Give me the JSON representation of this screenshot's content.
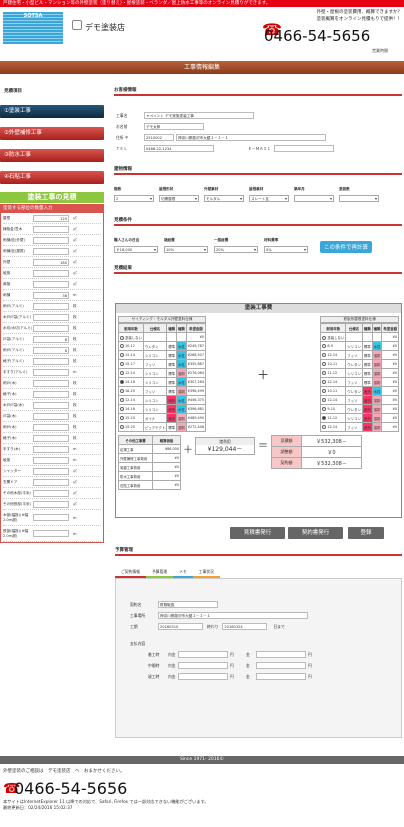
{
  "header": {
    "topbar": "戸建住宅・小型ビル・マンション等の外壁塗装（塗り替え）・屋根塗装・ベランダ／屋上防水工事等のオンライン見積りができます。",
    "logo_text": "SOTSA",
    "logo_sub": "",
    "shop_name": "デモ塗装店",
    "note1": "外壁・屋根の塗装費用、概算できますか？",
    "note2": "塗装概算をオンライン見積もりで提供！！",
    "phone": "0466-54-5656",
    "hours": "営業時間"
  },
  "title": "工事情報編集",
  "sidebar": {
    "head": "見積項目",
    "items": [
      "①塗装工事",
      "②外壁補修工事",
      "③防水工事",
      "④石貼工事"
    ],
    "estimate_title": "塗装工事の見積",
    "subhead": "塗装する部位の数量入力",
    "rows": [
      {
        "label": "屋根",
        "value": "120",
        "unit": "㎡"
      },
      {
        "label": "棟板金/笠木",
        "value": "",
        "unit": "㎡"
      },
      {
        "label": "雨樋/庇(外壁)",
        "value": "",
        "unit": "㎡"
      },
      {
        "label": "雨樋/庇(屋根)",
        "value": "",
        "unit": "㎡"
      },
      {
        "label": "外壁",
        "value": "180",
        "unit": "㎡"
      },
      {
        "label": "破風",
        "value": "",
        "unit": "㎡"
      },
      {
        "label": "鼻隠",
        "value": "",
        "unit": "㎡"
      },
      {
        "label": "雨樋",
        "value": "38",
        "unit": "m"
      },
      {
        "label": "雨戸(アルミ)",
        "value": "",
        "unit": "枚"
      },
      {
        "label": "木戸戸袋(アルミ)",
        "value": "",
        "unit": "枚"
      },
      {
        "label": "水切/水切(アルミ)",
        "value": "",
        "unit": "枚"
      },
      {
        "label": "戸袋(アルミ)",
        "value": "8",
        "unit": "枚"
      },
      {
        "label": "雨戸(アルミ)",
        "value": "8",
        "unit": "枚"
      },
      {
        "label": "格子(アルミ)",
        "value": "",
        "unit": "枚"
      },
      {
        "label": "手すり(アルミ)",
        "value": "",
        "unit": "m"
      },
      {
        "label": "雨戸(木)",
        "value": "",
        "unit": "枚"
      },
      {
        "label": "格子(木)",
        "value": "",
        "unit": "枚"
      },
      {
        "label": "木戸戸袋(木)",
        "value": "",
        "unit": "枚"
      },
      {
        "label": "戸袋(木)",
        "value": "",
        "unit": "枚"
      },
      {
        "label": "雨戸(木)",
        "value": "",
        "unit": "枚"
      },
      {
        "label": "格子(木)",
        "value": "",
        "unit": "枚"
      },
      {
        "label": "手すり(木)",
        "value": "",
        "unit": "m"
      },
      {
        "label": "破風",
        "value": "",
        "unit": "m"
      },
      {
        "label": "シャッター",
        "value": "",
        "unit": "㎡"
      },
      {
        "label": "玄関ドア",
        "value": "",
        "unit": "㎡"
      },
      {
        "label": "その他木部(平米)",
        "value": "",
        "unit": "㎡"
      },
      {
        "label": "その他鉄部(平米)",
        "value": "",
        "unit": "㎡"
      }
    ],
    "last_rows": [
      {
        "label": "木部(幅掛)(※幅2.0ｍ超)",
        "unit": "m"
      },
      {
        "label": "鉄部(幅掛)(※幅2.0ｍ超)",
        "unit": "m"
      }
    ]
  },
  "customer": {
    "title": "お客様情報",
    "rows": [
      {
        "label": "工事名",
        "value": "ｅペイント デモ実施塗装工事"
      },
      {
        "label": "お名前",
        "value": "デモ太郎"
      },
      {
        "label": "住所 〒",
        "value": "2510002",
        "value2": "神奈川県藤沢市大鋸１－１－１"
      },
      {
        "label": "ＴＥＬ",
        "value": "0466-22-1234",
        "label2": "Ｅ－ＭＡＩＬ",
        "value2": ""
      }
    ]
  },
  "building": {
    "title": "建物情報",
    "headers": [
      "階数",
      "屋根形状",
      "外壁素材",
      "屋根素材",
      "築年月",
      "塗装数"
    ],
    "values": [
      "2",
      "切妻屋根",
      "モルタル",
      "スレート瓦",
      "",
      ""
    ]
  },
  "conditions": {
    "title": "見積条件",
    "headers": [
      "職人さんの日当",
      "諸経費",
      "一般経費",
      "材料費率"
    ],
    "values": [
      "￥18,000",
      "10%",
      "20%",
      "0%"
    ],
    "recalc": "この条件で再計算"
  },
  "results": {
    "title": "見積結果",
    "box_title": "塗装工事費",
    "left_caption": "サイディング・モルタル外壁塗料仕様",
    "right_caption": "鉄板系屋根塗料仕様",
    "cols": [
      "耐用年数",
      "仕様名",
      "種類",
      "種類",
      "希望金額"
    ],
    "left_rows": [
      [
        "塗装しない",
        "",
        "",
        "",
        "¥0"
      ],
      [
        "10-12",
        "ウレタン",
        "標準",
        "水性",
        "¥249,787"
      ],
      [
        "12-14",
        "シリコン",
        "標準",
        "水性",
        "¥268,507"
      ],
      [
        "15-17",
        "フッソ",
        "標準",
        "水性",
        "¥355,867"
      ],
      [
        "12-14",
        "シリコン",
        "標準",
        "溶剤",
        "¥276,064"
      ],
      [
        "14-16",
        "シリコン",
        "標準",
        "水性",
        "¥307,264"
      ],
      [
        "18-20",
        "フッソ",
        "標準",
        "溶剤",
        "¥398,499"
      ],
      [
        "12-14",
        "シリコン",
        "遮熱",
        "水性",
        "¥446,375"
      ],
      [
        "14-16",
        "シリコン",
        "遮熱",
        "水性",
        "¥396,681"
      ],
      [
        "15-20",
        "ガイナ",
        "遮熱",
        "溶剤",
        "¥489,490"
      ],
      [
        "15-20",
        "ピュアテクト",
        "標準",
        "溶剤",
        "¥272,448"
      ]
    ],
    "right_rows": [
      [
        "塗装しない",
        "",
        "",
        "",
        "¥0"
      ],
      [
        "8-9",
        "シリコン",
        "標準",
        "水性",
        "¥0"
      ],
      [
        "12-14",
        "フッソ",
        "標準",
        "溶剤",
        "¥0"
      ],
      [
        "10-11",
        "ウレタン",
        "標準",
        "溶剤",
        "¥0"
      ],
      [
        "11-12",
        "シリコン",
        "標準",
        "溶剤",
        "¥0"
      ],
      [
        "12-14",
        "フッソ",
        "標準",
        "溶剤",
        "¥0"
      ],
      [
        "10-11",
        "ウレタン",
        "遮熱",
        "水性",
        "¥0"
      ],
      [
        "12-14",
        "フッソ",
        "遮熱",
        "溶剤",
        "¥0"
      ],
      [
        "9-10",
        "ウレタン",
        "遮熱",
        "溶剤",
        "¥0"
      ],
      [
        "11-12",
        "シリコン",
        "遮熱",
        "溶剤",
        "¥0"
      ],
      [
        "12-14",
        "フッソ",
        "遮熱",
        "溶剤",
        "¥0"
      ]
    ],
    "other_header": [
      "その他工事費",
      "概算価格"
    ],
    "other_rows": [
      [
        "足場工事",
        "¥86,000"
      ],
      [
        "外壁補修工事費用",
        "¥0"
      ],
      [
        "鳩避工事費用",
        "¥0"
      ],
      [
        "防水工事費用",
        "¥0"
      ],
      [
        "石貼工事費用",
        "¥0"
      ]
    ],
    "option_label": "諸費用",
    "option_value": "¥129,044－",
    "summary": [
      {
        "label": "見積額",
        "value": "￥532,308－"
      },
      {
        "label": "調整額",
        "value": "￥0"
      },
      {
        "label": "契約額",
        "value": "￥532,308－"
      }
    ],
    "btn_estimate": "見積書発行",
    "btn_contract": "契約書発行",
    "btn_register": "登録"
  },
  "schedule": {
    "title": "予算管理",
    "tabs": [
      "ご契約情報",
      "予算管理",
      "メモ",
      "工事状況"
    ],
    "rows": [
      {
        "label": "契約名",
        "value": "財務取扱"
      },
      {
        "label": "工事場所",
        "value": "神奈川県藤沢市大鋸１－１－１"
      },
      {
        "label": "工期",
        "value": "20160310",
        "mid": "終わり",
        "value2": "20160324",
        "end": "日まで"
      }
    ],
    "pay_label": "支払内容",
    "pay_rows": [
      "着工時",
      "中間時",
      "竣工時"
    ],
    "pay_cols": [
      "内金",
      "円",
      "金",
      "円"
    ]
  },
  "footer": {
    "bar": "Since 1971- 2016©",
    "line1": "外壁塗装のご相談は　デモ塗装店　へ　おまかせください。",
    "phone": "0466-54-5656",
    "note": "本サイトはInternetExplorer 11 以降での対応で、Safari, Firefox では一部対応できない機能がございます。",
    "updated": "最終更新日：02/24/2016 15:02:37"
  }
}
